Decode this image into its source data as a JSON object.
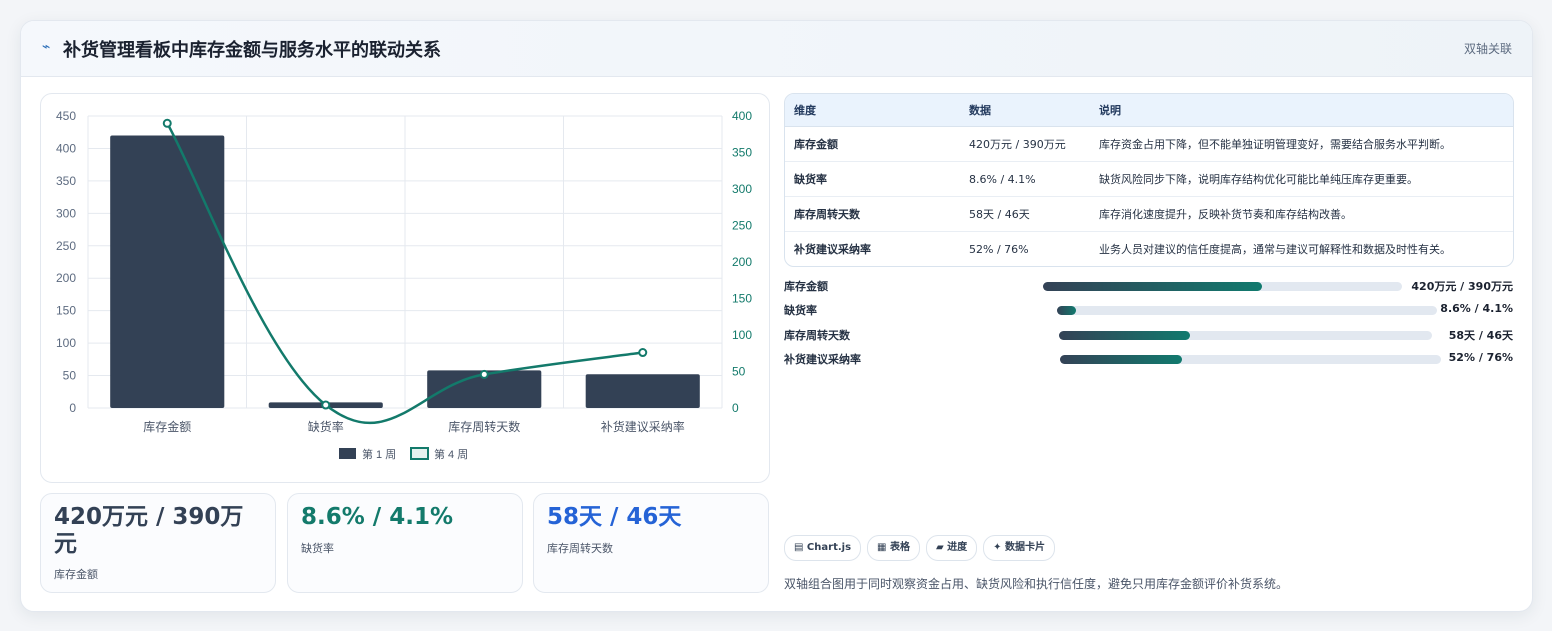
{
  "header": {
    "icon": "lightning-icon",
    "title": "补货管理看板中库存金额与服务水平的联动关系",
    "tag": "双轴关联"
  },
  "chart_data": {
    "type": "bar",
    "categories": [
      "库存金额",
      "缺货率",
      "库存周转天数",
      "补货建议采纳率"
    ],
    "series": [
      {
        "name": "第 1 周",
        "type": "bar",
        "axis": "left",
        "color": "#334155",
        "values": [
          420,
          8.6,
          58,
          52
        ]
      },
      {
        "name": "第 4 周",
        "type": "line",
        "axis": "right",
        "color": "#137a6b",
        "values": [
          390,
          4.1,
          46,
          76
        ]
      }
    ],
    "ylim_left": [
      0,
      450
    ],
    "yticks_left": [
      0,
      50,
      100,
      150,
      200,
      250,
      300,
      350,
      400,
      450
    ],
    "ylim_right": [
      0,
      400
    ],
    "yticks_right": [
      0,
      50,
      100,
      150,
      200,
      250,
      300,
      350,
      400
    ],
    "grid": true,
    "legend": "bottom"
  },
  "stats": [
    {
      "value": "420万元 / 390万元",
      "label": "库存金额",
      "color": "#334155"
    },
    {
      "value": "8.6% / 4.1%",
      "label": "缺货率",
      "color": "#137a6b"
    },
    {
      "value": "58天 / 46天",
      "label": "库存周转天数",
      "color": "#2563d6"
    }
  ],
  "table": {
    "headers": [
      "维度",
      "数据",
      "说明"
    ],
    "rows": [
      [
        "库存金额",
        "420万元 / 390万元",
        "库存资金占用下降，但不能单独证明管理变好，需要结合服务水平判断。"
      ],
      [
        "缺货率",
        "8.6% / 4.1%",
        "缺货风险同步下降，说明库存结构优化可能比单纯压库存更重要。"
      ],
      [
        "库存周转天数",
        "58天 / 46天",
        "库存消化速度提升，反映补货节奏和库存结构改善。"
      ],
      [
        "补货建议采纳率",
        "52% / 76%",
        "业务人员对建议的信任度提高，通常与建议可解释性和数据及时性有关。"
      ]
    ]
  },
  "progress": [
    {
      "label": "库存金额",
      "value": "420万元 / 390万元",
      "fraction": 0.61
    },
    {
      "label": "缺货率",
      "value": "8.6% / 4.1%",
      "fraction": 0.05
    },
    {
      "label": "库存周转天数",
      "value": "58天 / 46天",
      "fraction": 0.35
    },
    {
      "label": "补货建议采纳率",
      "value": "52% / 76%",
      "fraction": 0.32
    }
  ],
  "chips": [
    {
      "icon": "chart-icon",
      "label": "▤ Chart.js"
    },
    {
      "icon": "table-icon",
      "label": "▦ 表格"
    },
    {
      "icon": "progress-icon",
      "label": "▰ 进度"
    },
    {
      "icon": "card-icon",
      "label": "✦ 数据卡片"
    }
  ],
  "footnote": "双轴组合图用于同时观察资金占用、缺货风险和执行信任度，避免只用库存金额评价补货系统。"
}
